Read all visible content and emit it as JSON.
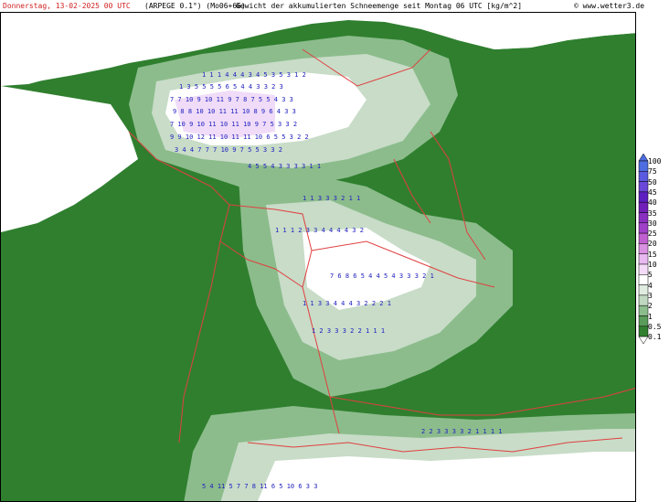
{
  "header": {
    "date": "Donnerstag, 13-02-2025  00 UTC",
    "model": "(ARPEGE 0.1°) (Mo06+66)",
    "title": "Gewicht der akkumulierten Schneemenge seit Montag 06 UTC [kg/m^2]",
    "copyright": "© www.wetter3.de"
  },
  "legend": {
    "levels": [
      "100",
      "75",
      "50",
      "45",
      "40",
      "35",
      "30",
      "25",
      "20",
      "15",
      "10",
      "5",
      "4",
      "3",
      "2",
      "1",
      "0.5",
      "0.1"
    ],
    "colors": [
      "#4d6de0",
      "#5a5ae0",
      "#6a48d8",
      "#5c20c0",
      "#7020b8",
      "#8a30c0",
      "#a040c8",
      "#c060d0",
      "#d890e0",
      "#e8b8f0",
      "#f4dcf8",
      "#ffffff",
      "#e0ece0",
      "#c0d8c0",
      "#8cbc8c",
      "#5a9c5a",
      "#2f7f2f",
      "#1a6a1a"
    ]
  },
  "map": {
    "colors": {
      "ground": "#2f7f2f",
      "light_green": "#5a9c5a",
      "pale_green": "#8cbc8c",
      "very_pale": "#c8dcc8",
      "white": "#ffffff",
      "lilac": "#f0dcf8",
      "border": "#e04040",
      "value_text": "#2020c0"
    },
    "numbers": [
      "1 1 1 4 4 4 3 4 5 3 5 3 1 2",
      "1 3 5 5 5 5 6 5 4 4 3 3 2 3",
      "7 7 10 9 10 11 9 7 8 7 5 5 4 3 3",
      "9 8 8 10 10 11 11 10 8 9 6 4 3 3",
      "7 10 9 10 11 10 11 10 9 7 5 3 3 2",
      "9 9 10 12 11 10 11 11 10 6 5 5 3 2 2",
      "3 4 4 7 7 7 10 9 7 5 5 3 3 2",
      "4 5 5 4 3 3 3 3 1 1",
      "1 1 3 3 3 2 1 1",
      "1 1 1 2 3 3 4 4 4 4 3 2",
      "7 6 8 6 5 4 4 5 4 3 3 3 2 1",
      "1 1 3 3 4 4 4 3 2 2 2 1",
      "1 2 3 3 3 2 2 1 1 1",
      "2 2 3 3 3 3 2 1 1 1 1",
      "5 4 11 5 7 7 8 11 6 5 10 6 3 3"
    ]
  }
}
